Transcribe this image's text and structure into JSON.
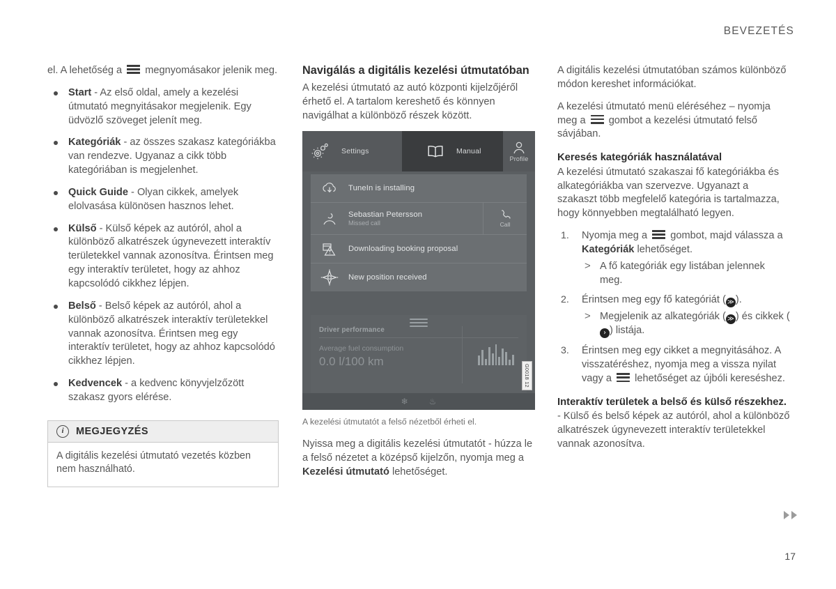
{
  "header": {
    "title": "BEVEZETÉS"
  },
  "footer": {
    "page_number": "17",
    "arrows_icon": "double-triangle-right-icon"
  },
  "left_column": {
    "intro_before_icon": "el. A lehetőség a",
    "hamburger_icon": "hamburger-menu-icon",
    "intro_after_icon": "megnyomásakor jelenik meg.",
    "bullets": [
      {
        "term": "Start",
        "text": " - Az első oldal, amely a kezelési útmutató megnyitásakor megjelenik. Egy üdvözlő szöveget jelenít meg."
      },
      {
        "term": "Kategóriák",
        "text": " - az összes szakasz kategóriákba van rendezve. Ugyanaz a cikk több kategóriában is megjelenhet."
      },
      {
        "term": "Quick Guide",
        "text": " - Olyan cikkek, amelyek elolvasása különösen hasznos lehet."
      },
      {
        "term": "Külső",
        "text": " - Külső képek az autóról, ahol a különböző alkatrészek úgynevezett interaktív területekkel vannak azonosítva. Érintsen meg egy interaktív területet, hogy az ahhoz kapcsolódó cikkhez lépjen."
      },
      {
        "term": "Belső",
        "text": " - Belső képek az autóról, ahol a különböző alkatrészek interaktív területekkel vannak azonosítva. Érintsen meg egy interaktív területet, hogy az ahhoz kapcsolódó cikkhez lépjen."
      },
      {
        "term": "Kedvencek",
        "text": " - a kedvenc könyvjelzőzött szakasz gyors elérése."
      }
    ],
    "note": {
      "icon": "info-circle-icon",
      "title": "MEGJEGYZÉS",
      "body": "A digitális kezelési útmutató vezetés közben nem használható."
    }
  },
  "middle_column": {
    "heading": "Navigálás a digitális kezelési útmutatóban",
    "lead": "A kezelési útmutató az autó központi kijelzőjéről érhető el. A tartalom kereshető és könnyen navigálhat a különböző részek között.",
    "caption": "A kezelési útmutatót a felső nézetből érheti el.",
    "closing_before_bold": "Nyissa meg a digitális kezelési útmutatót - húzza le a felső nézetet a középső kijelzőn, nyomja meg a ",
    "closing_bold": "Kezelési útmutató",
    "closing_after_bold": " lehetőséget.",
    "screenshot": {
      "image_code": "G0018 12",
      "topbar": {
        "settings": {
          "label": "Settings",
          "icon": "gear-icon"
        },
        "manual": {
          "label": "Manual",
          "icon": "book-icon",
          "selected": true
        },
        "profile": {
          "label": "Profile",
          "icon": "person-icon"
        }
      },
      "notifications": [
        {
          "icon": "cloud-download-icon",
          "title": "TuneIn is installing",
          "subtitle": "",
          "action": ""
        },
        {
          "icon": "contact-icon",
          "title": "Sebastian Petersson",
          "subtitle": "Missed call",
          "action": "Call",
          "action_icon": "phone-icon"
        },
        {
          "icon": "calendar-warning-icon",
          "title": "Downloading booking proposal",
          "subtitle": "",
          "action": ""
        },
        {
          "icon": "compass-icon",
          "title": "New position received",
          "subtitle": "",
          "action": ""
        }
      ],
      "bottom_panel": {
        "title": "Driver performance",
        "subtitle": "Average fuel consumption",
        "value": "0.0 l/100 km",
        "chart_icon": "bar-chart-icon",
        "handle_icon": "drag-handle-icon"
      },
      "climate_bar": {
        "left_icon": "fan-icon",
        "right_icon": "seat-heat-icon"
      }
    }
  },
  "right_column": {
    "para1": "A digitális kezelési útmutatóban számos különböző módon kereshet információkat.",
    "para2_before": "A kezelési útmutató menü eléréséhez – nyomja meg a",
    "para2_after": "gombot a kezelési útmutató felső sávjában.",
    "heading_search": "Keresés kategóriák használatával",
    "para3": "A kezelési útmutató szakaszai fő kategóriákba és alkategóriákba van szervezve. Ugyanazt a szakaszt több megfelelő kategória is tartalmazza, hogy könnyebben megtalálható legyen.",
    "steps": [
      {
        "before_icon": "Nyomja meg a",
        "after_icon_pre_bold": "gombot, majd válassza a ",
        "bold": "Kategóriák",
        "after_bold": " lehetőséget.",
        "sub": [
          "A fő kategóriák egy listában jelennek meg."
        ]
      },
      {
        "text_a": "Érintsen meg egy fő kategóriát (",
        "badge1": "≫",
        "text_b": ").",
        "sub_a": "Megjelenik az alkategóriák (",
        "sub_badge1": "≫",
        "sub_b": ") és cikkek (",
        "sub_badge2": "›",
        "sub_c": ") listája."
      },
      {
        "text_a": "Érintsen meg egy cikket a megnyitásához. A visszatéréshez, nyomja meg a vissza nyilat vagy a",
        "text_b": "lehetőséget az újbóli kereséshez."
      }
    ],
    "heading_interactive": "Interaktív területek a belső és külső részekhez.",
    "para4": "- Külső és belső képek az autóról, ahol a különböző alkatrészek úgynevezett interaktív területekkel vannak azonosítva."
  }
}
